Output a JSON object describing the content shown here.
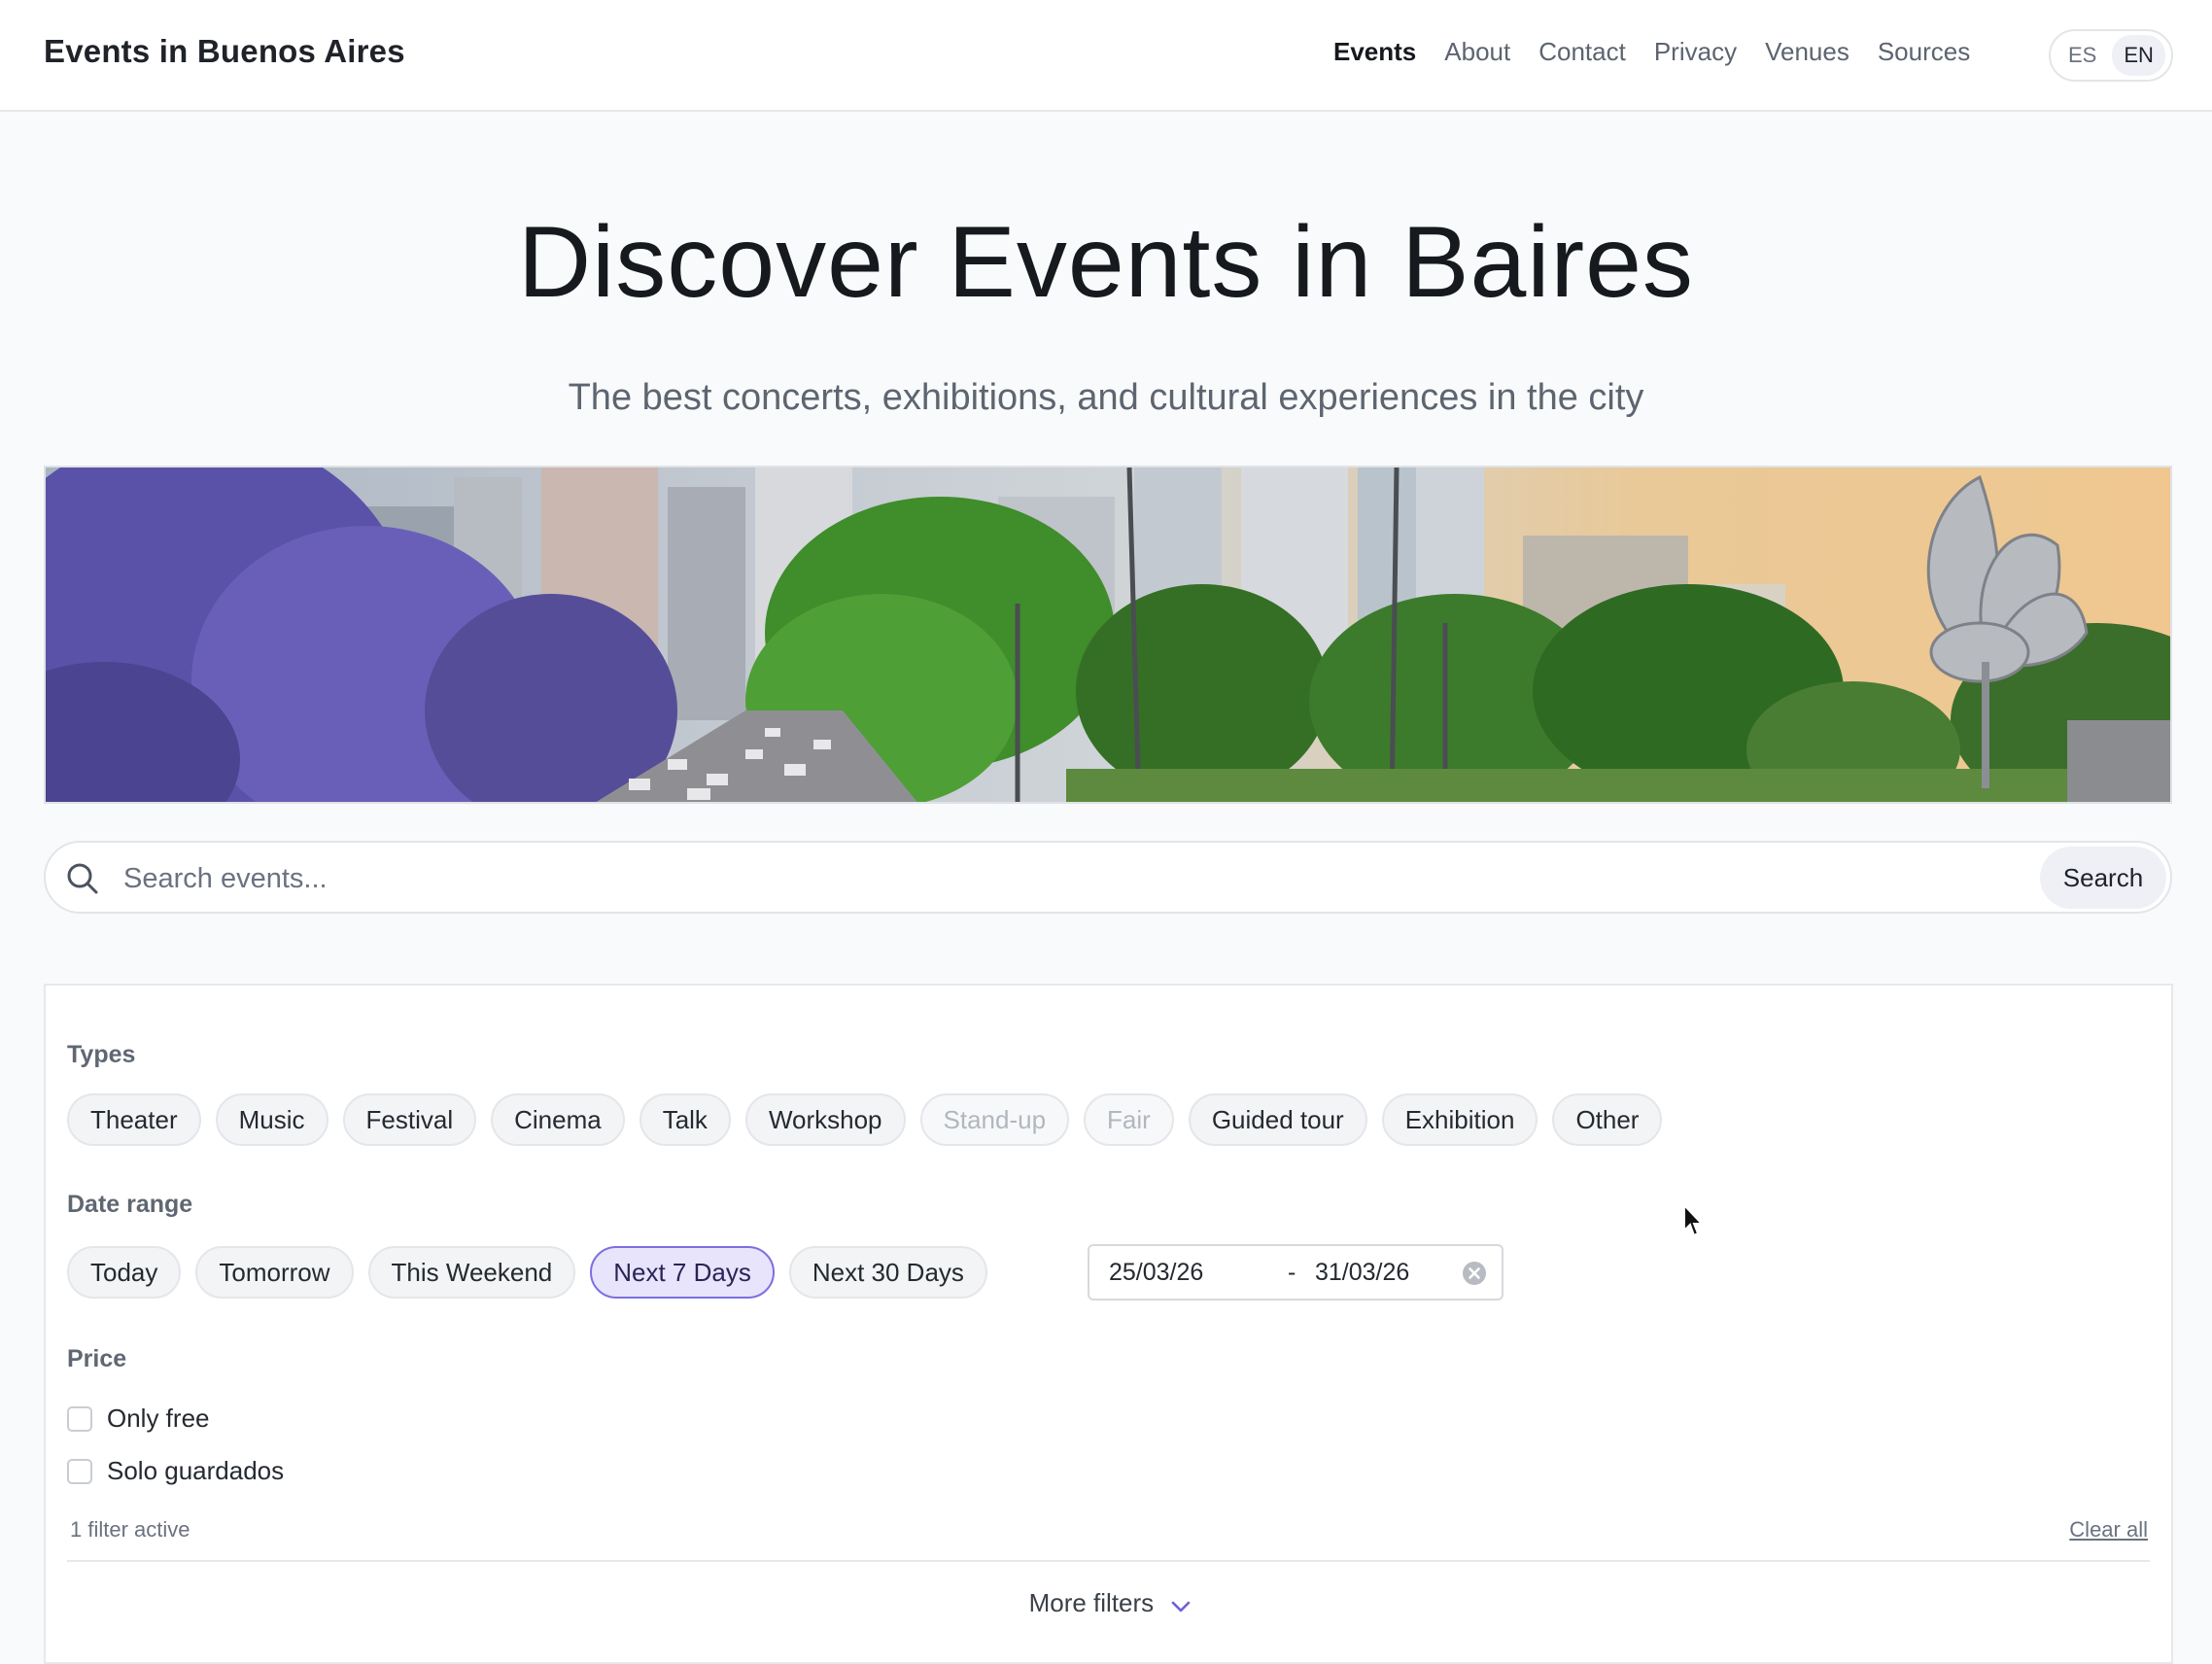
{
  "header": {
    "site_title": "Events in Buenos Aires",
    "nav": [
      {
        "label": "Events",
        "active": true
      },
      {
        "label": "About",
        "active": false
      },
      {
        "label": "Contact",
        "active": false
      },
      {
        "label": "Privacy",
        "active": false
      },
      {
        "label": "Venues",
        "active": false
      },
      {
        "label": "Sources",
        "active": false
      }
    ],
    "languages": {
      "es": "ES",
      "en": "EN",
      "selected": "EN"
    }
  },
  "hero": {
    "title": "Discover Events in Baires",
    "subtitle": "The best concerts, exhibitions, and cultural experiences in the city"
  },
  "search": {
    "placeholder": "Search events...",
    "value": "",
    "button_label": "Search"
  },
  "filters": {
    "types_label": "Types",
    "types": [
      {
        "label": "Theater",
        "enabled": true
      },
      {
        "label": "Music",
        "enabled": true
      },
      {
        "label": "Festival",
        "enabled": true
      },
      {
        "label": "Cinema",
        "enabled": true
      },
      {
        "label": "Talk",
        "enabled": true
      },
      {
        "label": "Workshop",
        "enabled": true
      },
      {
        "label": "Stand-up",
        "enabled": false
      },
      {
        "label": "Fair",
        "enabled": false
      },
      {
        "label": "Guided tour",
        "enabled": true
      },
      {
        "label": "Exhibition",
        "enabled": true
      },
      {
        "label": "Other",
        "enabled": true
      }
    ],
    "date_label": "Date range",
    "date_presets": [
      {
        "label": "Today",
        "selected": false
      },
      {
        "label": "Tomorrow",
        "selected": false
      },
      {
        "label": "This Weekend",
        "selected": false
      },
      {
        "label": "Next 7 Days",
        "selected": true
      },
      {
        "label": "Next 30 Days",
        "selected": false
      }
    ],
    "date_range": {
      "start": "25/03/26",
      "separator": "-",
      "end": "31/03/26"
    },
    "price_label": "Price",
    "checkboxes": [
      {
        "label": "Only free",
        "checked": false
      },
      {
        "label": "Solo guardados",
        "checked": false
      }
    ],
    "active_count_text": "1 filter active",
    "clear_all_label": "Clear all",
    "more_filters_label": "More filters"
  },
  "colors": {
    "accent": "#7c6fe0",
    "selected_chip_bg": "#e7e4fb",
    "page_bg": "#f9fafb"
  }
}
